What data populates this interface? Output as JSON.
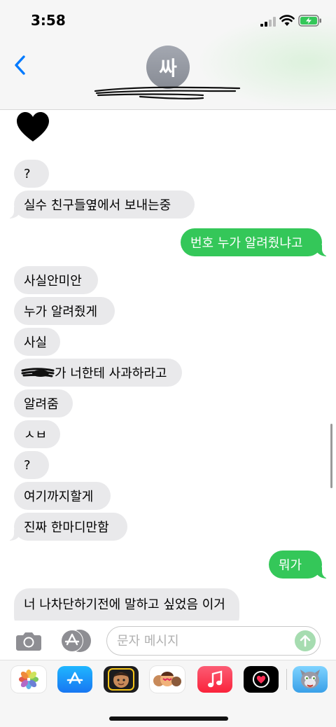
{
  "status_bar": {
    "time": "3:58"
  },
  "header": {
    "contact_initial": "싸",
    "contact_name_redacted": true
  },
  "messages": [
    {
      "side": "received",
      "text": "?"
    },
    {
      "side": "received",
      "text": "실수 친구들옆에서 보내는중"
    },
    {
      "side": "sent",
      "text": "번호 누가 알려줬냐고"
    },
    {
      "side": "received",
      "text": "사실안미안"
    },
    {
      "side": "received",
      "text": "누가 알려줬게"
    },
    {
      "side": "received",
      "text": "사실"
    },
    {
      "side": "received",
      "text": "가 너한테 사과하라고"
    },
    {
      "side": "received",
      "text": "알려줌"
    },
    {
      "side": "received",
      "text": "ㅅㅂ"
    },
    {
      "side": "received",
      "text": "?"
    },
    {
      "side": "received",
      "text": "여기까지할게"
    },
    {
      "side": "received",
      "text": "진짜 한마디만함"
    },
    {
      "side": "sent",
      "text": "뭐가"
    },
    {
      "side": "received",
      "text": "너 나차단하기전에 말하고 싶었음 이거"
    }
  ],
  "input": {
    "placeholder": "문자 메시지",
    "value": ""
  },
  "app_drawer": {
    "apps": [
      "photos-app-icon",
      "app-store-icon",
      "memoji-icon",
      "animoji-stickers-icon",
      "music-app-icon",
      "digital-touch-icon",
      "talking-tom-icon"
    ]
  },
  "colors": {
    "sent_bubble": "#34c759",
    "received_bubble": "#e9e9eb",
    "accent": "#007aff"
  }
}
